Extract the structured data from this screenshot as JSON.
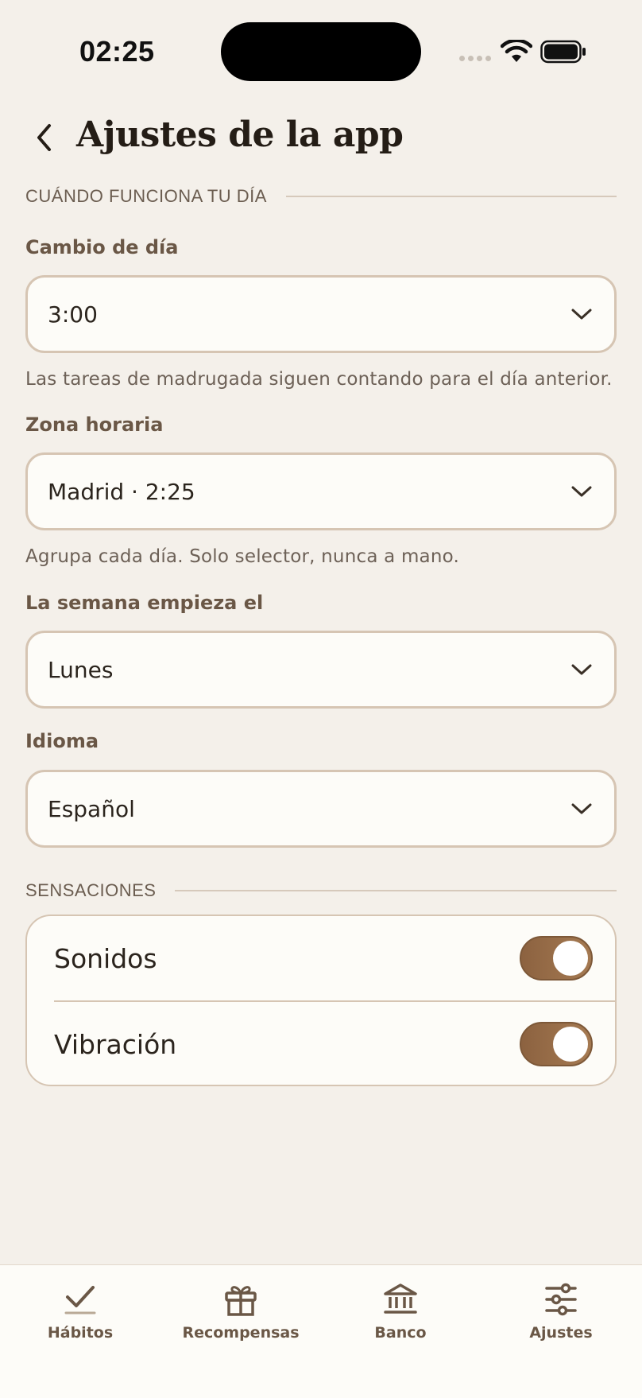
{
  "status": {
    "time": "02:25",
    "icons": [
      "cellular-signal-icon",
      "wifi-icon",
      "battery-icon"
    ]
  },
  "header": {
    "back_icon": "chevron-left-icon",
    "title": "Ajustes de la app"
  },
  "sections": {
    "dia": {
      "title": "CUÁNDO FUNCIONA TU DÍA"
    },
    "sensaciones": {
      "title": "SENSACIONES"
    }
  },
  "fields": {
    "day_change": {
      "label": "Cambio de día",
      "value": "3:00",
      "helper": "Las tareas de madrugada siguen contando para el día anterior."
    },
    "timezone": {
      "label": "Zona horaria",
      "value": "Madrid · 2:25",
      "helper": "Agrupa cada día. Solo selector, nunca a mano."
    },
    "week_start": {
      "label": "La semana empieza el",
      "value": "Lunes"
    },
    "language": {
      "label": "Idioma",
      "value": "Español"
    }
  },
  "toggles": [
    {
      "label": "Sonidos",
      "on": true
    },
    {
      "label": "Vibración",
      "on": true
    }
  ],
  "tabbar": {
    "items": [
      {
        "label": "Hábitos",
        "icon": "checkmark-icon"
      },
      {
        "label": "Recompensas",
        "icon": "gift-icon"
      },
      {
        "label": "Banco",
        "icon": "bank-icon"
      },
      {
        "label": "Ajustes",
        "icon": "sliders-icon",
        "active": true
      }
    ]
  },
  "colors": {
    "background": "#f4f0ea",
    "surface": "#fdfcf8",
    "border": "#d6c5b3",
    "accent": "#8c6240",
    "label": "#6a5746"
  }
}
